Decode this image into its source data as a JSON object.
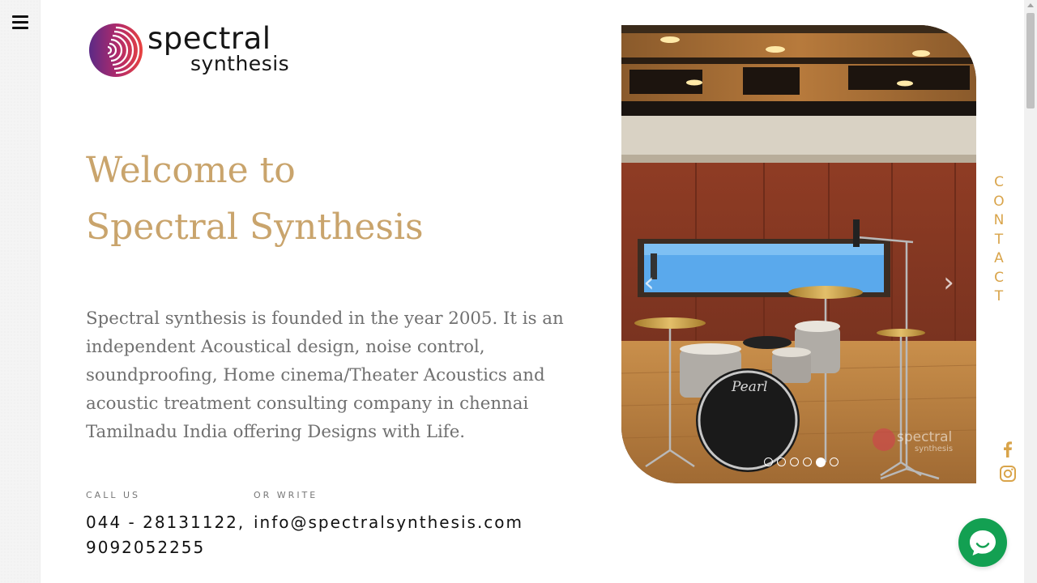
{
  "nav": {
    "menu_icon": "hamburger-menu-icon"
  },
  "logo": {
    "line1": "spectral",
    "line2": "synthesis"
  },
  "hero": {
    "title_line1": "Welcome to",
    "title_line2": "Spectral Synthesis",
    "description": "Spectral synthesis is founded in the year 2005. It is an independent Acoustical design, noise control, soundproofing, Home cinema/Theater Acoustics and acoustic treatment consulting company in chennai Tamilnadu India offering Designs with Life."
  },
  "contact": {
    "call_label": "CALL US",
    "call_value_1": "044 - 28131122,",
    "call_value_2": "9092052255",
    "write_label": "OR WRITE",
    "write_value": "info@spectralsynthesis.com"
  },
  "slider": {
    "prev_icon": "chevron-left-icon",
    "next_icon": "chevron-right-icon",
    "dot_count": 6,
    "active_dot": 5,
    "watermark_line1": "spectral",
    "watermark_line2": "synthesis",
    "drum_brand": "Pearl"
  },
  "side": {
    "contact_letters": [
      "C",
      "O",
      "N",
      "T",
      "A",
      "C",
      "T"
    ],
    "facebook_icon": "facebook-icon",
    "instagram_icon": "instagram-icon"
  },
  "chat": {
    "icon": "chat-bubble-icon"
  },
  "colors": {
    "accent": "#c9a46c",
    "contact": "#d9a44a",
    "chat": "#13a052",
    "text": "#707070"
  }
}
